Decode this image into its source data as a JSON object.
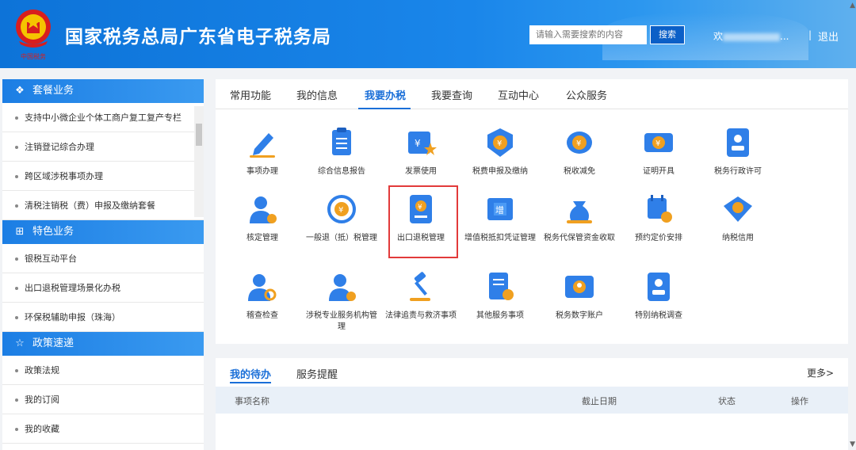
{
  "header": {
    "title": "国家税务总局广东省电子税务局",
    "search_placeholder": "请输入需要搜索的内容",
    "search_button": "搜索",
    "welcome": "欢",
    "welcome_tail": "...",
    "separator": "|",
    "logout": "退出"
  },
  "sidebar": {
    "sections": [
      {
        "title": "套餐业务",
        "icon": "layers-icon",
        "items": [
          "支持中小微企业个体工商户复工复产专栏",
          "注销登记综合办理",
          "跨区域涉税事项办理",
          "清税注销税（费）申报及缴纳套餐"
        ]
      },
      {
        "title": "特色业务",
        "icon": "grid-icon",
        "items": [
          "银税互动平台",
          "出口退税管理场景化办税",
          "环保税辅助申报（珠海）"
        ]
      },
      {
        "title": "政策速递",
        "icon": "star-icon",
        "items": [
          "政策法规",
          "我的订阅",
          "我的收藏"
        ]
      }
    ]
  },
  "tabs": [
    "常用功能",
    "我的信息",
    "我要办税",
    "我要查询",
    "互动中心",
    "公众服务"
  ],
  "active_tab": "我要办税",
  "tiles": [
    {
      "label": "事项办理",
      "icon": "pen-icon"
    },
    {
      "label": "综合信息报告",
      "icon": "clipboard-icon"
    },
    {
      "label": "发票使用",
      "icon": "invoice-icon"
    },
    {
      "label": "税费申报及缴纳",
      "icon": "tax-shield-icon"
    },
    {
      "label": "税收减免",
      "icon": "coin-stack-icon"
    },
    {
      "label": "证明开具",
      "icon": "ticket-icon"
    },
    {
      "label": "税务行政许可",
      "icon": "id-badge-icon"
    },
    {
      "label": "核定管理",
      "icon": "user-gear-icon"
    },
    {
      "label": "一般退（抵）税管理",
      "icon": "refund-cycle-icon"
    },
    {
      "label": "出口退税管理",
      "icon": "export-refund-icon"
    },
    {
      "label": "增值税抵扣凭证管理",
      "icon": "vat-receipt-icon"
    },
    {
      "label": "税务代保管资金收取",
      "icon": "money-bag-icon"
    },
    {
      "label": "预约定价安排",
      "icon": "calendar-clock-icon"
    },
    {
      "label": "纳税信用",
      "icon": "credit-shield-icon"
    },
    {
      "label": "稽查检查",
      "icon": "inspect-icon"
    },
    {
      "label": "涉税专业服务机构管理",
      "icon": "agency-icon"
    },
    {
      "label": "法律追责与救济事项",
      "icon": "gavel-icon"
    },
    {
      "label": "其他服务事项",
      "icon": "service-doc-icon"
    },
    {
      "label": "税务数字账户",
      "icon": "digital-account-icon"
    },
    {
      "label": "特别纳税调查",
      "icon": "special-survey-icon"
    }
  ],
  "todo": {
    "tabs": [
      "我的待办",
      "服务提醒"
    ],
    "more": "更多>",
    "columns": [
      "事项名称",
      "截止日期",
      "状态",
      "操作"
    ]
  },
  "colors": {
    "accent": "#1a6fd8",
    "header": "#1a86ea",
    "highlight": "#e23a3a"
  }
}
